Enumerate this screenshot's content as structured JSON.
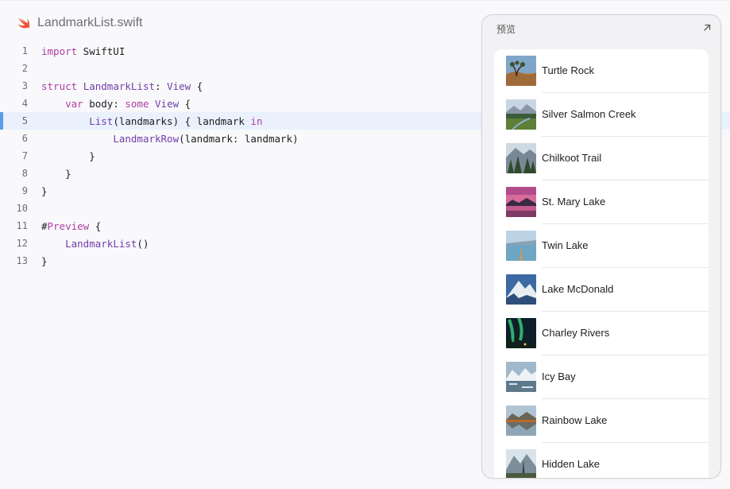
{
  "file": {
    "name": "LandmarkList.swift",
    "icon": "swift-icon"
  },
  "code": {
    "highlighted_line": 5,
    "lines": [
      {
        "no": "1",
        "segments": [
          {
            "t": "import",
            "c": "kw"
          },
          {
            "t": " SwiftUI",
            "c": ""
          }
        ]
      },
      {
        "no": "2",
        "segments": []
      },
      {
        "no": "3",
        "segments": [
          {
            "t": "struct",
            "c": "kw"
          },
          {
            "t": " ",
            "c": ""
          },
          {
            "t": "LandmarkList",
            "c": "ty"
          },
          {
            "t": ": ",
            "c": ""
          },
          {
            "t": "View",
            "c": "ty"
          },
          {
            "t": " {",
            "c": ""
          }
        ]
      },
      {
        "no": "4",
        "segments": [
          {
            "t": "    ",
            "c": ""
          },
          {
            "t": "var",
            "c": "kw"
          },
          {
            "t": " body: ",
            "c": ""
          },
          {
            "t": "some",
            "c": "kw"
          },
          {
            "t": " ",
            "c": ""
          },
          {
            "t": "View",
            "c": "ty"
          },
          {
            "t": " {",
            "c": ""
          }
        ]
      },
      {
        "no": "5",
        "segments": [
          {
            "t": "        ",
            "c": ""
          },
          {
            "t": "List",
            "c": "fn"
          },
          {
            "t": "(landmarks) { landmark ",
            "c": ""
          },
          {
            "t": "in",
            "c": "kw"
          }
        ]
      },
      {
        "no": "6",
        "segments": [
          {
            "t": "            ",
            "c": ""
          },
          {
            "t": "LandmarkRow",
            "c": "fn"
          },
          {
            "t": "(landmark: landmark)",
            "c": ""
          }
        ]
      },
      {
        "no": "7",
        "segments": [
          {
            "t": "        }",
            "c": ""
          }
        ]
      },
      {
        "no": "8",
        "segments": [
          {
            "t": "    }",
            "c": ""
          }
        ]
      },
      {
        "no": "9",
        "segments": [
          {
            "t": "}",
            "c": ""
          }
        ]
      },
      {
        "no": "10",
        "segments": []
      },
      {
        "no": "11",
        "segments": [
          {
            "t": "#",
            "c": ""
          },
          {
            "t": "Preview",
            "c": "kw"
          },
          {
            "t": " {",
            "c": ""
          }
        ]
      },
      {
        "no": "12",
        "segments": [
          {
            "t": "    ",
            "c": ""
          },
          {
            "t": "LandmarkList",
            "c": "fn"
          },
          {
            "t": "()",
            "c": ""
          }
        ]
      },
      {
        "no": "13",
        "segments": [
          {
            "t": "}",
            "c": ""
          }
        ]
      }
    ]
  },
  "preview": {
    "title": "预览",
    "expand_icon": "expand-arrow-icon",
    "landmarks": [
      {
        "name": "Turtle Rock",
        "thumb": "desert-rock"
      },
      {
        "name": "Silver Salmon Creek",
        "thumb": "creek-meadow"
      },
      {
        "name": "Chilkoot Trail",
        "thumb": "forest-mountains"
      },
      {
        "name": "St. Mary Lake",
        "thumb": "pink-sunset-lake"
      },
      {
        "name": "Twin Lake",
        "thumb": "dock-lake"
      },
      {
        "name": "Lake McDonald",
        "thumb": "snowy-peak"
      },
      {
        "name": "Charley Rivers",
        "thumb": "aurora-night"
      },
      {
        "name": "Icy Bay",
        "thumb": "icy-mountains"
      },
      {
        "name": "Rainbow Lake",
        "thumb": "reflection-lake"
      },
      {
        "name": "Hidden Lake",
        "thumb": "mountain-valley"
      }
    ]
  },
  "colors": {
    "keyword": "#ad3da4",
    "type": "#703daa",
    "highlight_bg": "#eaf1fd",
    "highlight_bar": "#5b9bea",
    "swift_orange": "#f05138"
  }
}
